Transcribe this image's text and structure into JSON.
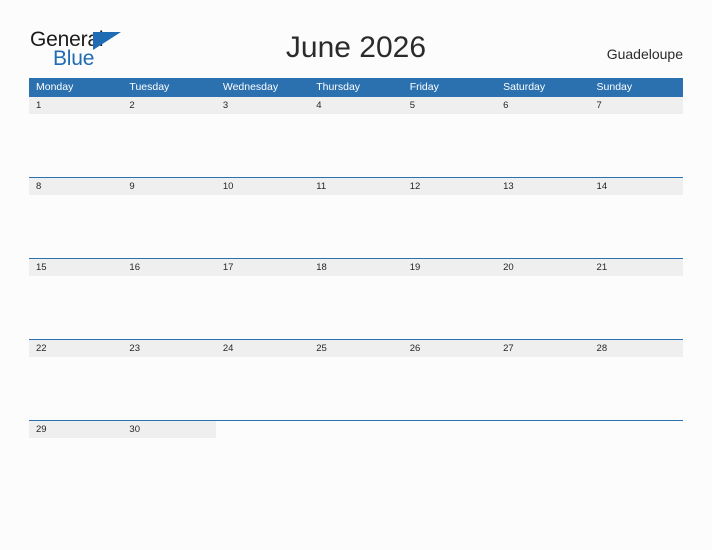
{
  "brand": {
    "name_part1": "General",
    "name_part2": "Blue",
    "flag_icon": "blue-triangle-flag",
    "color_primary": "#1f6cb4",
    "color_text": "#1b1b1b"
  },
  "header": {
    "title": "June 2026",
    "region": "Guadeloupe"
  },
  "calendar": {
    "header_bg": "#2b71b0",
    "date_band_bg": "#efefef",
    "row_divider": "#2b71b0",
    "weekdays": [
      "Monday",
      "Tuesday",
      "Wednesday",
      "Thursday",
      "Friday",
      "Saturday",
      "Sunday"
    ],
    "weeks": [
      {
        "days": [
          "1",
          "2",
          "3",
          "4",
          "5",
          "6",
          "7"
        ]
      },
      {
        "days": [
          "8",
          "9",
          "10",
          "11",
          "12",
          "13",
          "14"
        ]
      },
      {
        "days": [
          "15",
          "16",
          "17",
          "18",
          "19",
          "20",
          "21"
        ]
      },
      {
        "days": [
          "22",
          "23",
          "24",
          "25",
          "26",
          "27",
          "28"
        ]
      },
      {
        "days": [
          "29",
          "30",
          "",
          "",
          "",
          "",
          ""
        ]
      }
    ]
  }
}
